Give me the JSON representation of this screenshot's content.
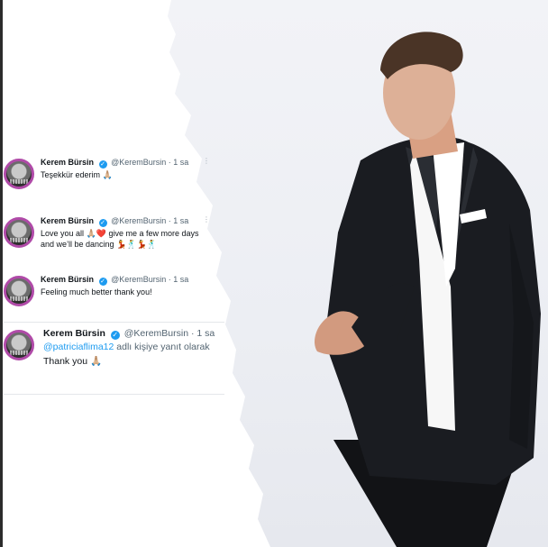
{
  "tweets": [
    {
      "name": "Kerem Bürsin",
      "handle": "@KeremBursin",
      "time": "· 1 sa",
      "text": "Teşekkür ederim 🙏🏼"
    },
    {
      "name": "Kerem Bürsin",
      "handle": "@KeremBursin",
      "time": "· 1 sa",
      "text": "Love you all 🙏🏼❤️ give me a few more days and we’ll be dancing 💃🕺💃🕺"
    },
    {
      "name": "Kerem Bürsin",
      "handle": "@KeremBursin",
      "time": "· 1 sa",
      "text": "Feeling much better thank you!"
    },
    {
      "name": "Kerem Bürsin",
      "handle": "@KeremBursin",
      "time": "· 1 sa",
      "reply_handle": "@patriciaflima12",
      "reply_suffix": " adlı kişiye yanıt olarak",
      "text": "Thank you 🙏🏼"
    }
  ],
  "colors": {
    "verified": "#1d9bf0",
    "avatar_ring": "#b04aa8",
    "text_primary": "#0f1419",
    "text_secondary": "#536471"
  },
  "icons": {
    "verified": "verified-badge-icon",
    "more": "more-dots-icon"
  }
}
